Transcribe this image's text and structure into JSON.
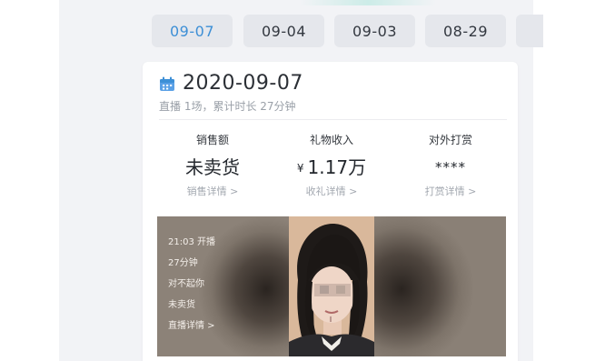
{
  "date_tabs": [
    {
      "label": "09-07",
      "active": true
    },
    {
      "label": "09-04",
      "active": false
    },
    {
      "label": "09-03",
      "active": false
    },
    {
      "label": "08-29",
      "active": false
    }
  ],
  "card": {
    "date": "2020-09-07",
    "summary": "直播 1场，累计时长 27分钟",
    "stats": [
      {
        "title": "销售额",
        "value": "未卖货",
        "link": "销售详情 >"
      },
      {
        "title": "礼物收入",
        "currency": "¥",
        "value": "1.17万",
        "link": "收礼详情 >"
      },
      {
        "title": "对外打赏",
        "value": "****",
        "link": "打赏详情 >"
      }
    ]
  },
  "live_session": {
    "start": "21:03 开播",
    "duration": "27分钟",
    "title": "对不起你",
    "sales": "未卖货",
    "detail_link": "直播详情 >"
  },
  "colors": {
    "accent": "#3d8fd6",
    "tab_bg": "#e5e7ec",
    "page_bg": "#f2f3f6"
  },
  "icons": {
    "calendar": "calendar-icon"
  }
}
